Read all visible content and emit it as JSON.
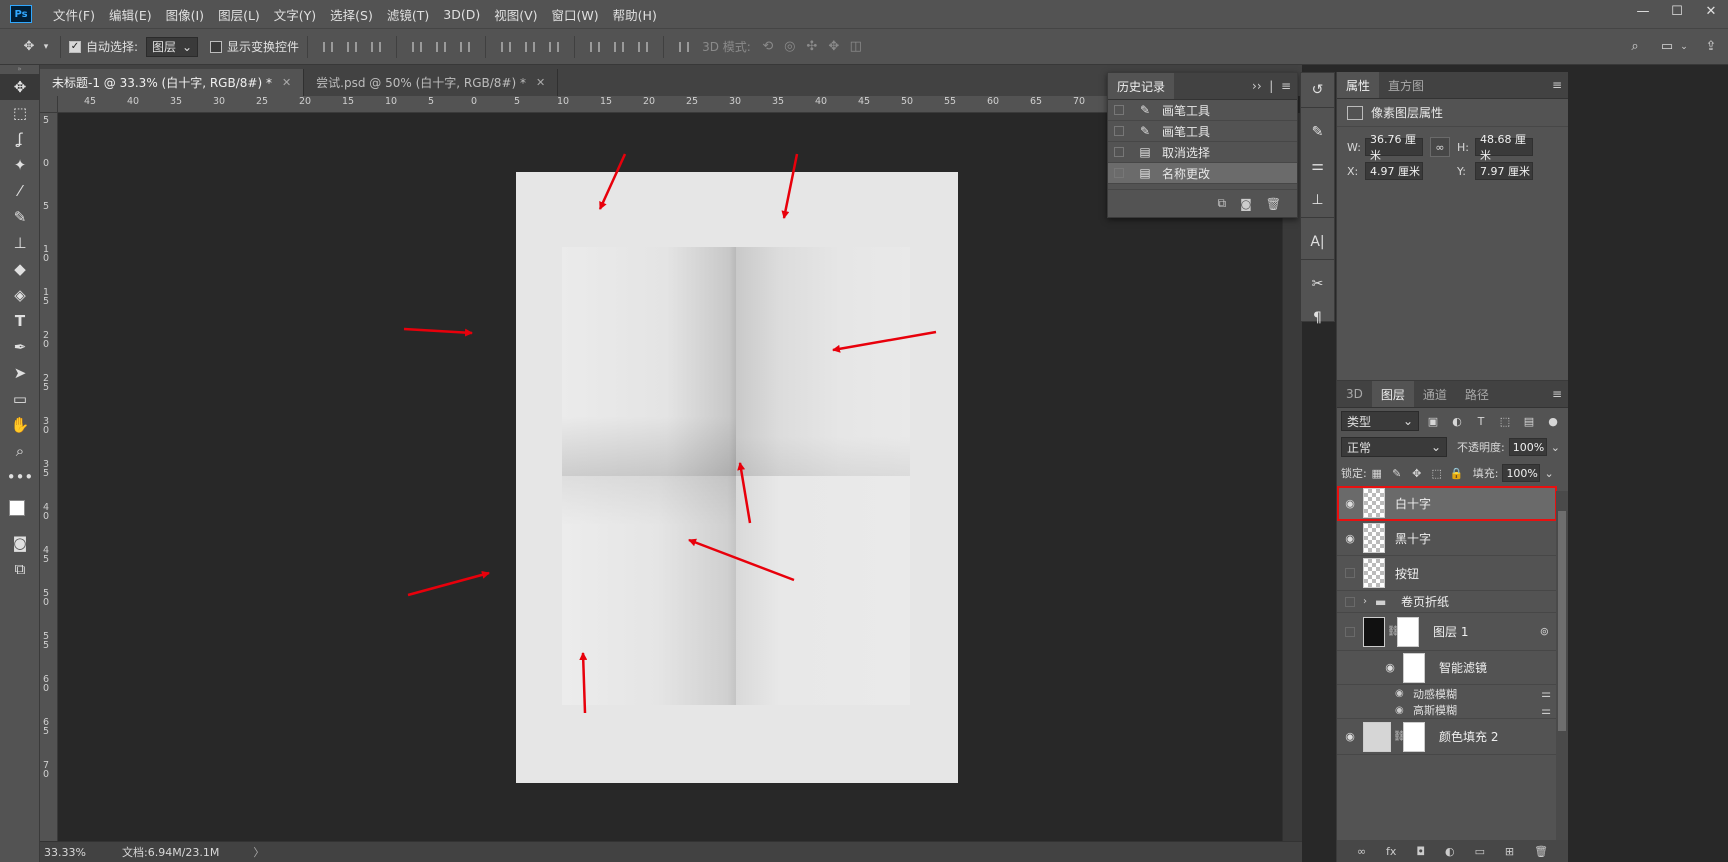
{
  "app": {
    "logo": "Ps"
  },
  "menu": [
    "文件(F)",
    "编辑(E)",
    "图像(I)",
    "图层(L)",
    "文字(Y)",
    "选择(S)",
    "滤镜(T)",
    "3D(D)",
    "视图(V)",
    "窗口(W)",
    "帮助(H)"
  ],
  "window": {
    "minimize": "—",
    "maximize": "☐",
    "close": "✕"
  },
  "options": {
    "auto_select_label": "自动选择:",
    "auto_select_value": "图层",
    "show_transform_label": "显示变换控件",
    "mode3d_label": "3D 模式:"
  },
  "tabs": [
    {
      "label": "未标题-1 @ 33.3% (白十字, RGB/8#) *",
      "close": "✕"
    },
    {
      "label": "尝试.psd @ 50% (白十字, RGB/8#) *",
      "close": "✕"
    }
  ],
  "ruler_h": [
    "45",
    "40",
    "35",
    "30",
    "25",
    "20",
    "15",
    "10",
    "5",
    "0",
    "5",
    "10",
    "15",
    "20",
    "25",
    "30",
    "35",
    "40",
    "45",
    "50",
    "55",
    "60",
    "65",
    "70"
  ],
  "ruler_v": [
    "5",
    "0",
    "5",
    "1 0",
    "1 5",
    "2 0",
    "2 5",
    "3 0",
    "3 5",
    "4 0",
    "4 5",
    "5 0",
    "5 5",
    "6 0",
    "6 5",
    "7 0"
  ],
  "status": {
    "zoom": "33.33%",
    "doc": "文档:6.94M/23.1M"
  },
  "history": {
    "tab": "历史记录",
    "items": [
      {
        "label": "画笔工具",
        "icon": "brush-icon"
      },
      {
        "label": "画笔工具",
        "icon": "brush-icon"
      },
      {
        "label": "取消选择",
        "icon": "document-icon"
      },
      {
        "label": "名称更改",
        "icon": "document-icon"
      }
    ]
  },
  "properties": {
    "tabs": [
      "属性",
      "直方图"
    ],
    "title": "像素图层属性",
    "w_label": "W:",
    "w": "36.76 厘米",
    "h_label": "H:",
    "h": "48.68 厘米",
    "x_label": "X:",
    "x": "4.97 厘米",
    "y_label": "Y:",
    "y": "7.97 厘米"
  },
  "layers": {
    "tabs": [
      "3D",
      "图层",
      "通道",
      "路径"
    ],
    "filter_kind": "类型",
    "blend_mode": "正常",
    "opacity_label": "不透明度:",
    "opacity": "100%",
    "lock_label": "锁定:",
    "fill_label": "填充:",
    "fill": "100%",
    "items": [
      {
        "name": "白十字",
        "visible": true,
        "thumb": "checker"
      },
      {
        "name": "黑十字",
        "visible": true,
        "thumb": "checker"
      },
      {
        "name": "按钮",
        "visible": false,
        "thumb": "checker"
      },
      {
        "name": "卷页折纸",
        "visible": false,
        "thumb": "folder"
      },
      {
        "name": "图层 1",
        "visible": false,
        "thumb": "black"
      }
    ],
    "smart_filter": "智能滤镜",
    "filters": [
      "动感模糊",
      "高斯模糊"
    ],
    "fill_layer": "颜色填充 2",
    "footer": [
      "∞",
      "fx",
      "◘",
      "◐",
      "▭",
      "⊞",
      "🗑"
    ]
  }
}
